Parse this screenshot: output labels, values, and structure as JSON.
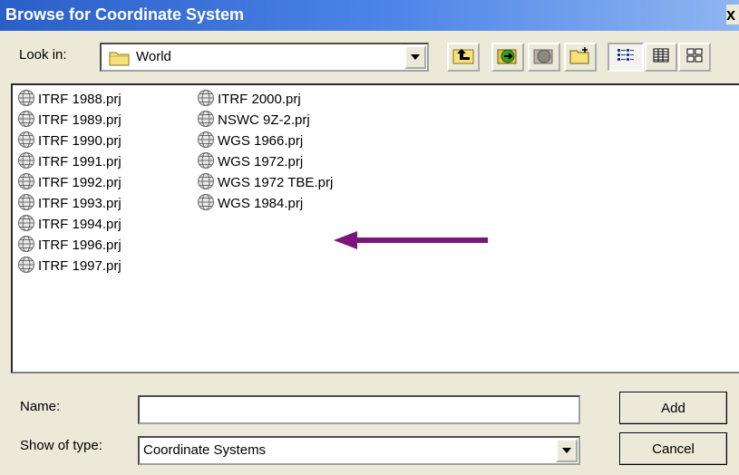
{
  "dialog": {
    "title": "Browse for Coordinate System",
    "close_glyph": "x"
  },
  "toolbar": {
    "look_in_label": "Look in:",
    "look_in_value": "World",
    "buttons": [
      {
        "name": "up-one-level-icon"
      },
      {
        "name": "connect-folder-icon"
      },
      {
        "name": "disconnect-folder-icon"
      },
      {
        "name": "new-folder-icon"
      },
      {
        "name": "list-view-icon",
        "pressed": true
      },
      {
        "name": "details-view-icon"
      },
      {
        "name": "thumbnails-view-icon"
      }
    ]
  },
  "files": {
    "column1": [
      "ITRF 1988.prj",
      "ITRF 1989.prj",
      "ITRF 1990.prj",
      "ITRF 1991.prj",
      "ITRF 1992.prj",
      "ITRF 1993.prj",
      "ITRF 1994.prj",
      "ITRF 1996.prj",
      "ITRF 1997.prj"
    ],
    "column2": [
      "ITRF 2000.prj",
      "NSWC 9Z-2.prj",
      "WGS 1966.prj",
      "WGS 1972.prj",
      "WGS 1972 TBE.prj",
      "WGS 1984.prj"
    ],
    "highlight_arrow_color": "#7b157b"
  },
  "form": {
    "name_label": "Name:",
    "name_value": "",
    "type_label": "Show of type:",
    "type_value": "Coordinate Systems",
    "add_label": "Add",
    "cancel_label": "Cancel"
  }
}
